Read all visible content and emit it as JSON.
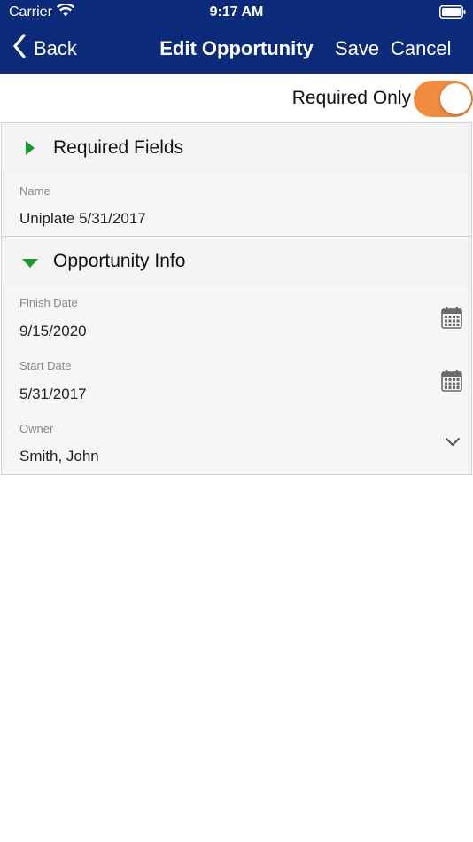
{
  "status_bar": {
    "carrier": "Carrier",
    "time": "9:17 AM"
  },
  "nav": {
    "back_label": "Back",
    "title": "Edit Opportunity",
    "save_label": "Save",
    "cancel_label": "Cancel"
  },
  "required_only": {
    "label": "Required Only",
    "on": true
  },
  "sections": {
    "required": {
      "title": "Required Fields",
      "expanded": false
    },
    "opportunity": {
      "title": "Opportunity Info",
      "expanded": true
    }
  },
  "fields": {
    "name": {
      "label": "Name",
      "value": "Uniplate 5/31/2017"
    },
    "finish_date": {
      "label": "Finish Date",
      "value": "9/15/2020"
    },
    "start_date": {
      "label": "Start Date",
      "value": "5/31/2017"
    },
    "owner": {
      "label": "Owner",
      "value": "Smith, John"
    }
  },
  "colors": {
    "nav_bg": "#0b2a7a",
    "toggle_on": "#f28a3e",
    "triangle": "#1a9a2a"
  },
  "icons": [
    "wifi-icon",
    "battery-icon",
    "chevron-left-icon",
    "triangle-right-icon",
    "triangle-down-icon",
    "calendar-icon",
    "chevron-down-icon"
  ]
}
